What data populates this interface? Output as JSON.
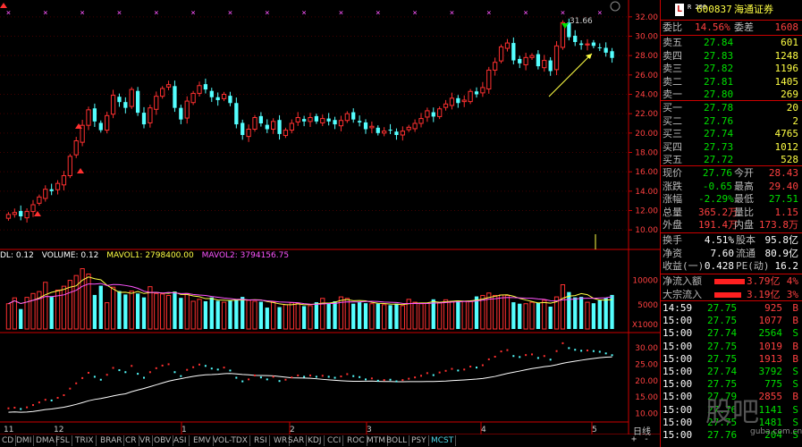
{
  "stock": {
    "code": "600837",
    "name": "海通证券",
    "badge": "L",
    "badge_small": "R 200"
  },
  "price_axis": [
    "32.00",
    "30.00",
    "28.00",
    "26.00",
    "24.00",
    "22.00",
    "20.00",
    "18.00",
    "16.00",
    "14.00",
    "12.00",
    "10.00"
  ],
  "vol_axis": [
    "10000",
    "5000",
    "X1000"
  ],
  "ind_axis": [
    "30.00",
    "25.00",
    "20.00",
    "15.00",
    "10.00"
  ],
  "peak_label": "31.66",
  "volume_header": {
    "v1": "DL: 0.12",
    "v2": "VOLUME: 0.12",
    "v3": "MAVOL1: 2798400.00",
    "v4": "MAVOL2: 3794156.75"
  },
  "x_labels": [
    "12",
    "1",
    "2",
    "3",
    "4",
    "5"
  ],
  "x_label_prefix": "11",
  "indicator_tabs": [
    "CD",
    "DMI",
    "DMA",
    "FSL",
    "TRIX",
    "BRAR",
    "CR",
    "VR",
    "OBV",
    "ASI",
    "EMV",
    "VOL-TDX",
    "RSI",
    "WR",
    "SAR",
    "KDJ",
    "CCI",
    "ROC",
    "MTM",
    "BOLL",
    "PSY",
    "MCST"
  ],
  "bottom_buttons": {
    "period": "日线",
    "plus": "+",
    "minus": "-"
  },
  "order_book": {
    "weibi_label": "委比",
    "weibi": "14.56%",
    "weicha_label": "委差",
    "weicha": "1608",
    "asks": [
      {
        "label": "卖五",
        "price": "27.84",
        "vol": "601"
      },
      {
        "label": "卖四",
        "price": "27.83",
        "vol": "1248"
      },
      {
        "label": "卖三",
        "price": "27.82",
        "vol": "1196"
      },
      {
        "label": "卖二",
        "price": "27.81",
        "vol": "1405"
      },
      {
        "label": "卖一",
        "price": "27.80",
        "vol": "269"
      }
    ],
    "bids": [
      {
        "label": "买一",
        "price": "27.78",
        "vol": "20"
      },
      {
        "label": "买二",
        "price": "27.76",
        "vol": "2"
      },
      {
        "label": "买三",
        "price": "27.74",
        "vol": "4765"
      },
      {
        "label": "买四",
        "price": "27.73",
        "vol": "1012"
      },
      {
        "label": "买五",
        "price": "27.72",
        "vol": "528"
      }
    ]
  },
  "quote": [
    {
      "l1": "现价",
      "v1": "27.76",
      "l2": "今开",
      "v2": "28.43"
    },
    {
      "l1": "涨跌",
      "v1": "-0.65",
      "l2": "最高",
      "v2": "29.40"
    },
    {
      "l1": "涨幅",
      "v1": "-2.29%",
      "l2": "最低",
      "v2": "27.51"
    },
    {
      "l1": "总量",
      "v1": "365.2万",
      "l2": "量比",
      "v2": "1.15"
    },
    {
      "l1": "外盘",
      "v1": "191.4万",
      "l2": "内盘",
      "v2": "173.8万"
    }
  ],
  "stats": [
    {
      "l1": "换手",
      "v1": "4.51%",
      "l2": "股本",
      "v2": "95.8亿"
    },
    {
      "l1": "净资",
      "v1": "7.60",
      "l2": "流通",
      "v2": "80.9亿"
    },
    {
      "l1": "收益(一)",
      "v1": "0.428",
      "l2": "PE(动)",
      "v2": "16.2"
    }
  ],
  "flows": [
    {
      "label": "净流入额",
      "value": "3.79亿",
      "pct": "4%"
    },
    {
      "label": "大宗流入",
      "value": "3.19亿",
      "pct": "3%"
    }
  ],
  "ticks": [
    {
      "time": "14:59",
      "price": "27.75",
      "vol": "925",
      "side": "B"
    },
    {
      "time": "15:00",
      "price": "27.75",
      "vol": "1077",
      "side": "B"
    },
    {
      "time": "15:00",
      "price": "27.74",
      "vol": "2564",
      "side": "S"
    },
    {
      "time": "15:00",
      "price": "27.75",
      "vol": "1019",
      "side": "B"
    },
    {
      "time": "15:00",
      "price": "27.75",
      "vol": "1913",
      "side": "B"
    },
    {
      "time": "15:00",
      "price": "27.74",
      "vol": "3792",
      "side": "S"
    },
    {
      "time": "15:00",
      "price": "27.75",
      "vol": "775",
      "side": "S"
    },
    {
      "time": "15:00",
      "price": "27.79",
      "vol": "2855",
      "side": "B"
    },
    {
      "time": "15:00",
      "price": "27.76",
      "vol": "1141",
      "side": "S"
    },
    {
      "time": "15:00",
      "price": "27.75",
      "vol": "1481",
      "side": "S"
    },
    {
      "time": "15:00",
      "price": "27.76",
      "vol": "204",
      "side": "S"
    }
  ],
  "watermark": "股吧",
  "watermark_url": "guba.com.cn",
  "chart_data": {
    "type": "candlestick",
    "price_ylim": [
      9,
      33
    ],
    "closes": [
      11.6,
      11.8,
      11.4,
      11.9,
      12.6,
      13.4,
      14.2,
      14.0,
      14.8,
      15.6,
      17.6,
      19.2,
      20.8,
      22.4,
      21.2,
      20.3,
      21.8,
      23.9,
      23.2,
      22.6,
      24.5,
      22.1,
      20.9,
      22.6,
      23.8,
      24.6,
      25.0,
      22.6,
      21.4,
      23.3,
      24.1,
      24.9,
      24.5,
      23.7,
      23.4,
      24.0,
      23.1,
      20.9,
      19.8,
      20.4,
      21.6,
      21.0,
      20.4,
      21.2,
      19.9,
      20.3,
      21.0,
      21.6,
      21.2,
      21.6,
      21.2,
      21.5,
      21.2,
      20.9,
      21.3,
      22.0,
      21.4,
      21.1,
      20.4,
      20.7,
      20.0,
      20.2,
      20.3,
      19.8,
      20.2,
      20.6,
      21.0,
      21.5,
      22.3,
      21.7,
      22.5,
      23.0,
      23.6,
      23.1,
      23.4,
      24.3,
      24.0,
      24.7,
      26.5,
      27.3,
      28.9,
      29.3,
      27.5,
      27.2,
      27.8,
      28.0,
      26.9,
      27.5,
      26.4,
      29.0,
      31.4,
      29.9,
      29.4,
      29.1,
      29.2,
      29.0,
      28.8,
      28.3,
      27.76
    ],
    "volumes": [
      5200,
      6400,
      4100,
      6500,
      7300,
      7700,
      9600,
      6600,
      8000,
      8800,
      10000,
      11000,
      12400,
      11300,
      7000,
      8900,
      5400,
      8600,
      7800,
      7100,
      7800,
      7300,
      6500,
      8700,
      7300,
      7200,
      6900,
      7700,
      6400,
      7300,
      5700,
      6100,
      5700,
      6500,
      5800,
      5500,
      5800,
      6100,
      6600,
      5900,
      5700,
      5600,
      4400,
      5600,
      4500,
      5000,
      5400,
      5300,
      4700,
      4800,
      5500,
      6300,
      5300,
      5700,
      6600,
      6300,
      5200,
      5500,
      5300,
      5200,
      5200,
      5000,
      4900,
      5200,
      4800,
      6100,
      5500,
      5200,
      5300,
      6100,
      5400,
      6000,
      5700,
      5800,
      5700,
      5700,
      6700,
      6900,
      7400,
      6900,
      7000,
      6900,
      5500,
      5200,
      5200,
      5500,
      5400,
      5900,
      4600,
      6600,
      9100,
      7600,
      6500,
      6600,
      5500,
      5300,
      5900,
      6400,
      7000
    ]
  }
}
